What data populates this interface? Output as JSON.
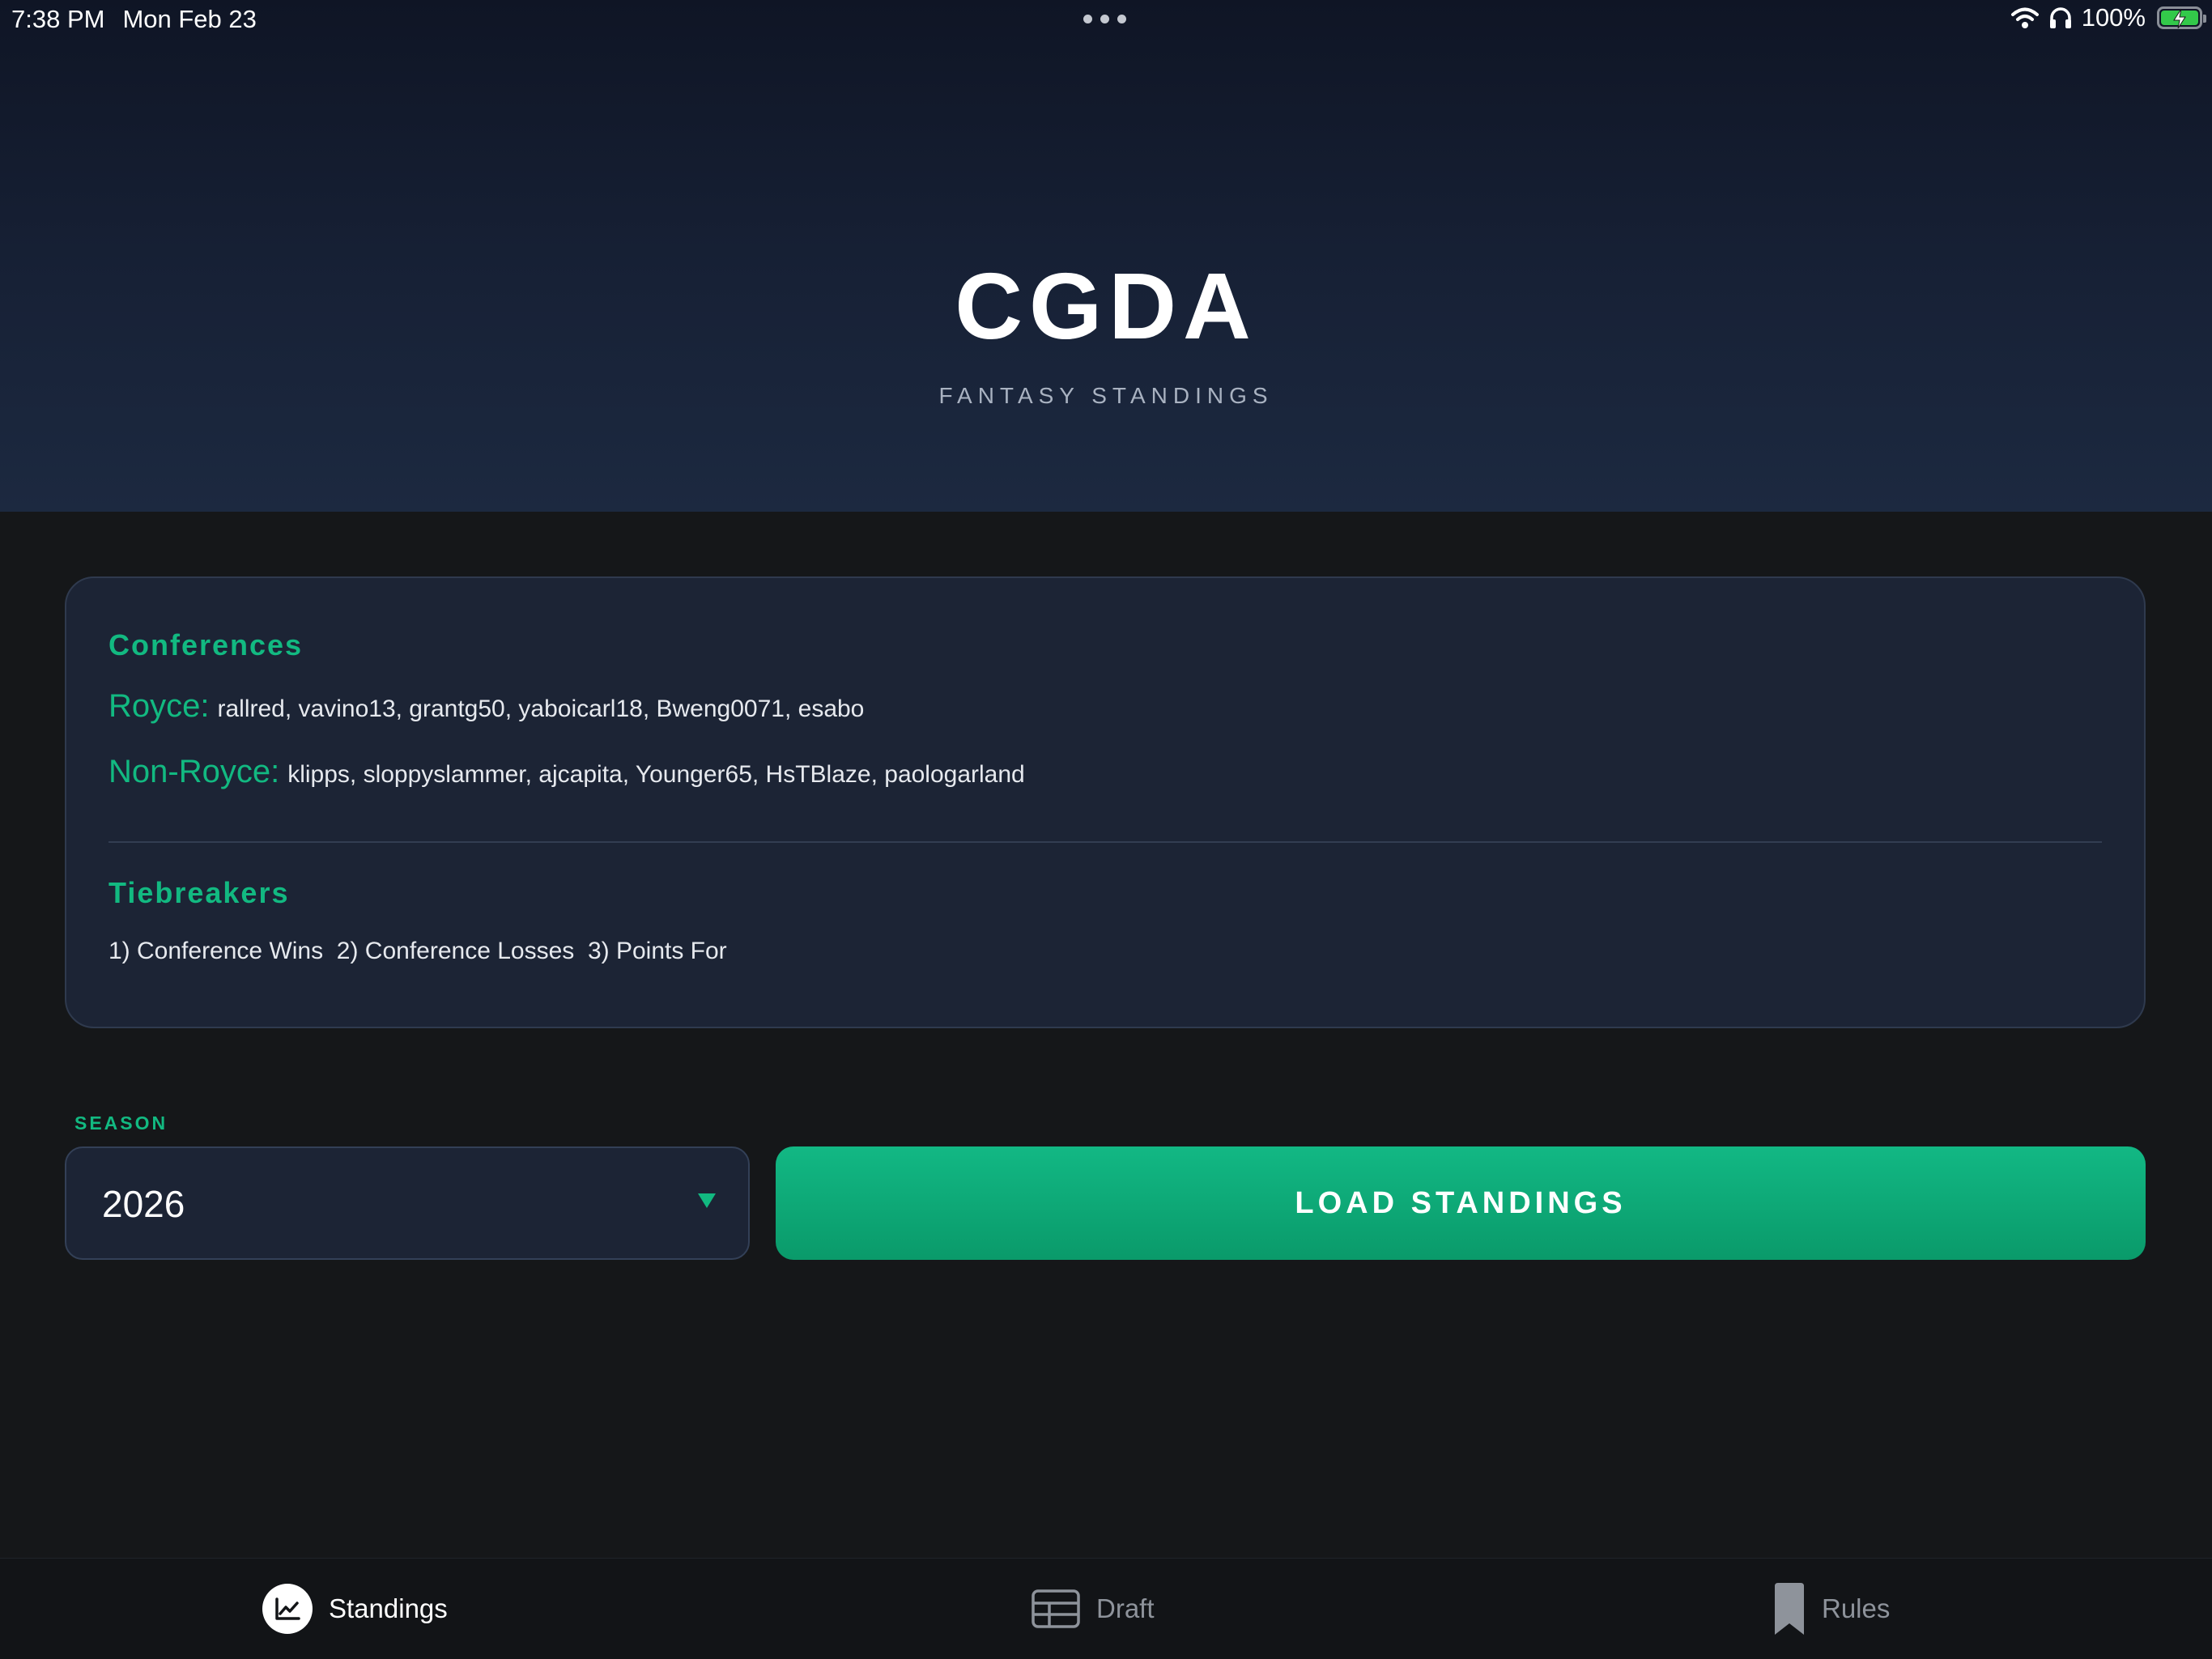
{
  "status_bar": {
    "time": "7:38 PM",
    "date": "Mon Feb 23",
    "battery": "100%",
    "icons": [
      "more-dots-icon",
      "wifi-icon",
      "headphones-icon",
      "battery-charging-icon"
    ]
  },
  "header": {
    "title": "CGDA",
    "subtitle": "FANTASY STANDINGS"
  },
  "info": {
    "conferences_title": "Conferences",
    "conferences": [
      {
        "label": "Royce:",
        "members": "rallred, vavino13, grantg50, yaboicarl18, Bweng0071, esabo"
      },
      {
        "label": "Non-Royce:",
        "members": "klipps, sloppyslammer, ajcapita, Younger65, HsTBlaze, paologarland"
      }
    ],
    "tiebreakers_title": "Tiebreakers",
    "tiebreakers_text": "1) Conference Wins  2) Conference Losses  3) Points For"
  },
  "controls": {
    "season_label": "SEASON",
    "season_value": "2026",
    "load_button": "LOAD STANDINGS"
  },
  "tabs": [
    {
      "label": "Standings",
      "icon": "chart-icon",
      "active": true
    },
    {
      "label": "Draft",
      "icon": "table-icon",
      "active": false
    },
    {
      "label": "Rules",
      "icon": "bookmark-icon",
      "active": false
    }
  ],
  "colors": {
    "accent": "#12b981",
    "background": "#151719",
    "card": "#1c2435",
    "header_top": "#0f1525",
    "header_bottom": "#1c2940"
  }
}
